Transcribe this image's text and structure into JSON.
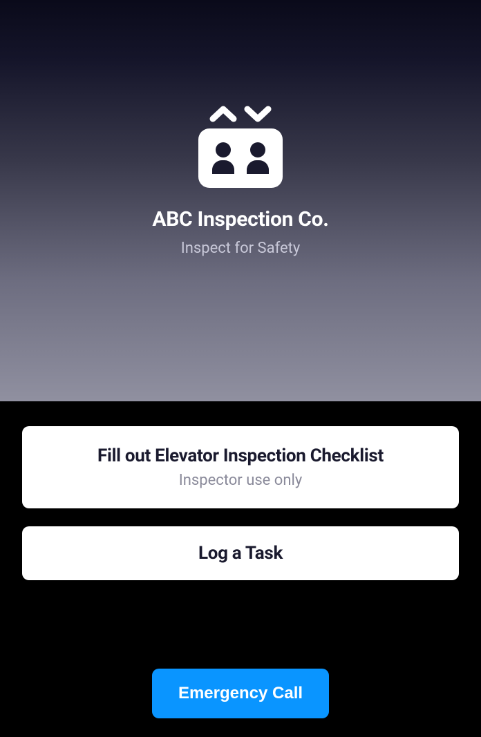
{
  "company": {
    "name": "ABC Inspection Co.",
    "tagline": "Inspect for Safety"
  },
  "actions": {
    "checklist": {
      "title": "Fill out Elevator Inspection Checklist",
      "subtitle": "Inspector use only"
    },
    "logTask": {
      "title": "Log a Task"
    }
  },
  "emergency": {
    "label": "Emergency Call"
  }
}
